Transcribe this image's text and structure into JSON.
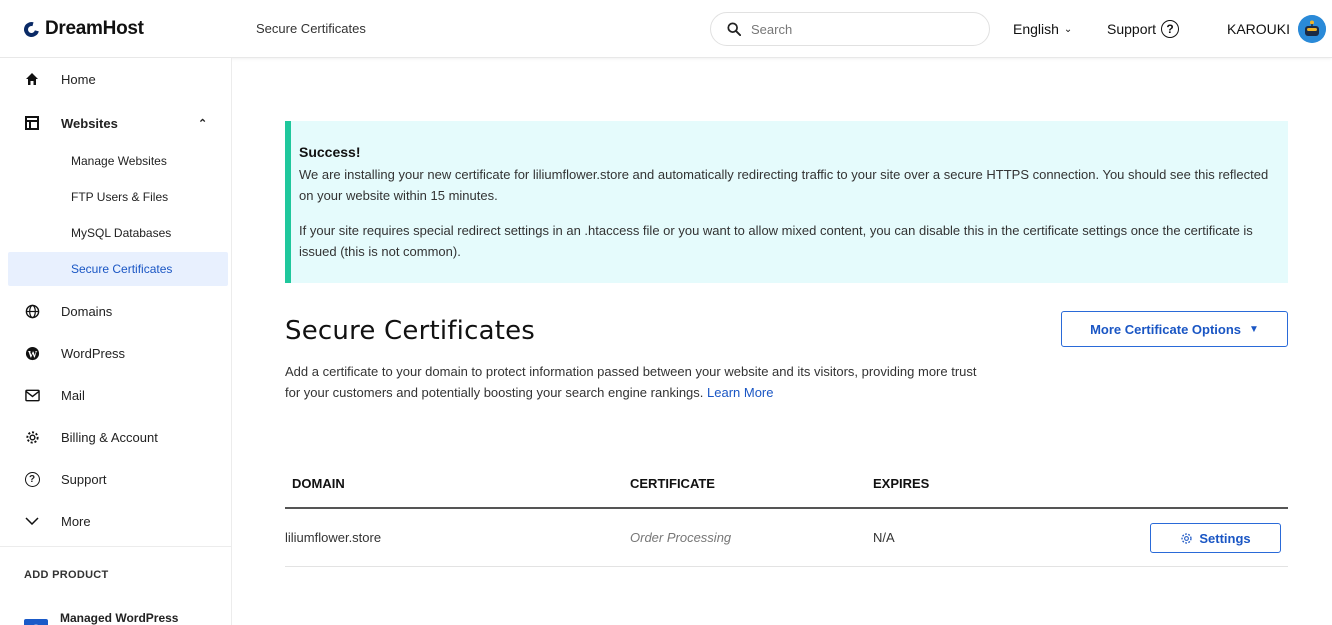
{
  "header": {
    "brand": "DreamHost",
    "breadcrumb": "Secure Certificates",
    "search_placeholder": "Search",
    "language": "English",
    "support": "Support",
    "user": "KAROUKI"
  },
  "sidebar": {
    "items": [
      {
        "label": "Home",
        "icon": "home-icon"
      },
      {
        "label": "Websites",
        "icon": "websites-icon"
      },
      {
        "label": "Domains",
        "icon": "globe-icon"
      },
      {
        "label": "WordPress",
        "icon": "wordpress-icon"
      },
      {
        "label": "Mail",
        "icon": "mail-icon"
      },
      {
        "label": "Billing & Account",
        "icon": "gear-icon"
      },
      {
        "label": "Support",
        "icon": "help-icon"
      },
      {
        "label": "More",
        "icon": "chevron-down-icon"
      }
    ],
    "sub_items": [
      {
        "label": "Manage Websites"
      },
      {
        "label": "FTP Users & Files"
      },
      {
        "label": "MySQL Databases"
      },
      {
        "label": "Secure Certificates",
        "active": true
      }
    ],
    "add_product": "ADD PRODUCT",
    "product": "Managed WordPress"
  },
  "alert": {
    "title": "Success!",
    "p1": "We are installing your new certificate for liliumflower.store and automatically redirecting traffic to your site over a secure HTTPS connection. You should see this reflected on your website within 15 minutes.",
    "p2": "If your site requires special redirect settings in an .htaccess file or you want to allow mixed content, you can disable this in the certificate settings once the certificate is issued (this is not common)."
  },
  "main": {
    "title": "Secure Certificates",
    "more_options": "More Certificate Options",
    "description": "Add a certificate to your domain to protect information passed between your website and its visitors, providing more trust for your customers and potentially boosting your search engine rankings.",
    "learn_more": "Learn More"
  },
  "table": {
    "headers": [
      "DOMAIN",
      "CERTIFICATE",
      "EXPIRES"
    ],
    "rows": [
      {
        "domain": "liliumflower.store",
        "certificate": "Order Processing",
        "expires": "N/A",
        "action": "Settings"
      }
    ]
  },
  "colors": {
    "accent": "#1a56c4",
    "success_bar": "#1fc79c",
    "alert_bg": "#e5fbfc",
    "active_bg": "#e8f0fe"
  }
}
